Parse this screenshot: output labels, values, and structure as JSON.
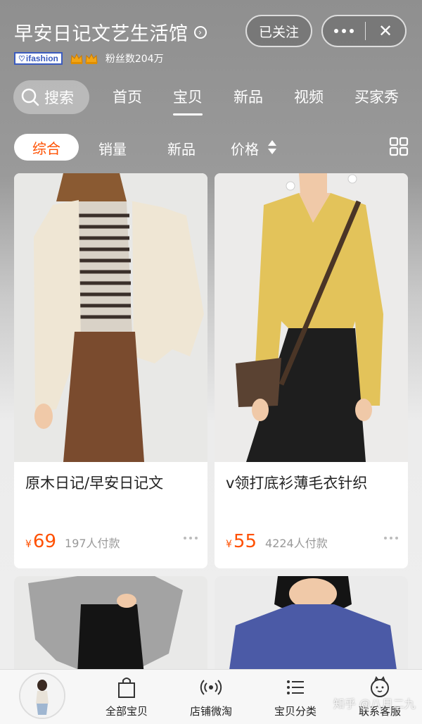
{
  "header": {
    "shop_name": "早安日记文艺生活馆",
    "follow_label": "已关注",
    "brand_badge": "ifashion",
    "fans": "粉丝数204万"
  },
  "nav": {
    "search_label": "搜索",
    "tabs": [
      {
        "label": "首页",
        "active": false
      },
      {
        "label": "宝贝",
        "active": true
      },
      {
        "label": "新品",
        "active": false
      },
      {
        "label": "视频",
        "active": false
      },
      {
        "label": "买家秀",
        "active": false
      }
    ]
  },
  "sort": {
    "items": [
      "综合",
      "销量",
      "新品",
      "价格"
    ],
    "active": "综合"
  },
  "products": [
    {
      "title": "原木日记/早安日记文",
      "currency": "¥",
      "price": "69",
      "sales": "197人付款"
    },
    {
      "title": "v领打底衫薄毛衣针织",
      "currency": "¥",
      "price": "55",
      "sales": "4224人付款"
    },
    {
      "title": "",
      "currency": "",
      "price": "",
      "sales": ""
    },
    {
      "title": "",
      "currency": "",
      "price": "",
      "sales": ""
    }
  ],
  "bottom_bar": {
    "items": [
      {
        "label": "全部宝贝",
        "icon": "shopping-bag-icon"
      },
      {
        "label": "店铺微淘",
        "icon": "broadcast-icon"
      },
      {
        "label": "宝贝分类",
        "icon": "category-list-icon"
      },
      {
        "label": "联系客服",
        "icon": "customer-service-icon"
      }
    ]
  },
  "watermark": "知乎 @八月二九",
  "colors": {
    "accent": "#ff5000",
    "header_gray": "#8f8f8f",
    "card_bg": "#ffffff"
  }
}
